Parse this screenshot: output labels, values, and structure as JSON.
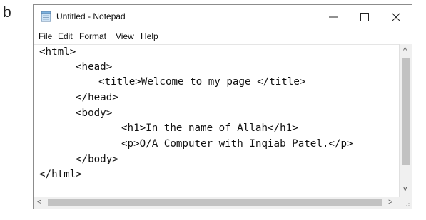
{
  "figure_label": "b",
  "window": {
    "title": "Untitled - Notepad",
    "icon": "notepad-icon",
    "controls": {
      "minimize": "minimize-icon",
      "maximize": "maximize-icon",
      "close": "close-icon"
    }
  },
  "menu": {
    "items": [
      "File",
      "Edit",
      "Format",
      "View",
      "Help"
    ]
  },
  "editor": {
    "lines": [
      "<html>",
      "<head>",
      "<title>Welcome to my page </title>",
      "</head>",
      "<body>",
      "<h1>In the name of Allah</h1>",
      "<p>O/A Computer with Inqiab Patel.</p>",
      "</body>",
      "</html>"
    ]
  },
  "scrollbars": {
    "up_arrow": "^",
    "down_arrow": "v",
    "left_arrow": "<",
    "right_arrow": ">"
  }
}
